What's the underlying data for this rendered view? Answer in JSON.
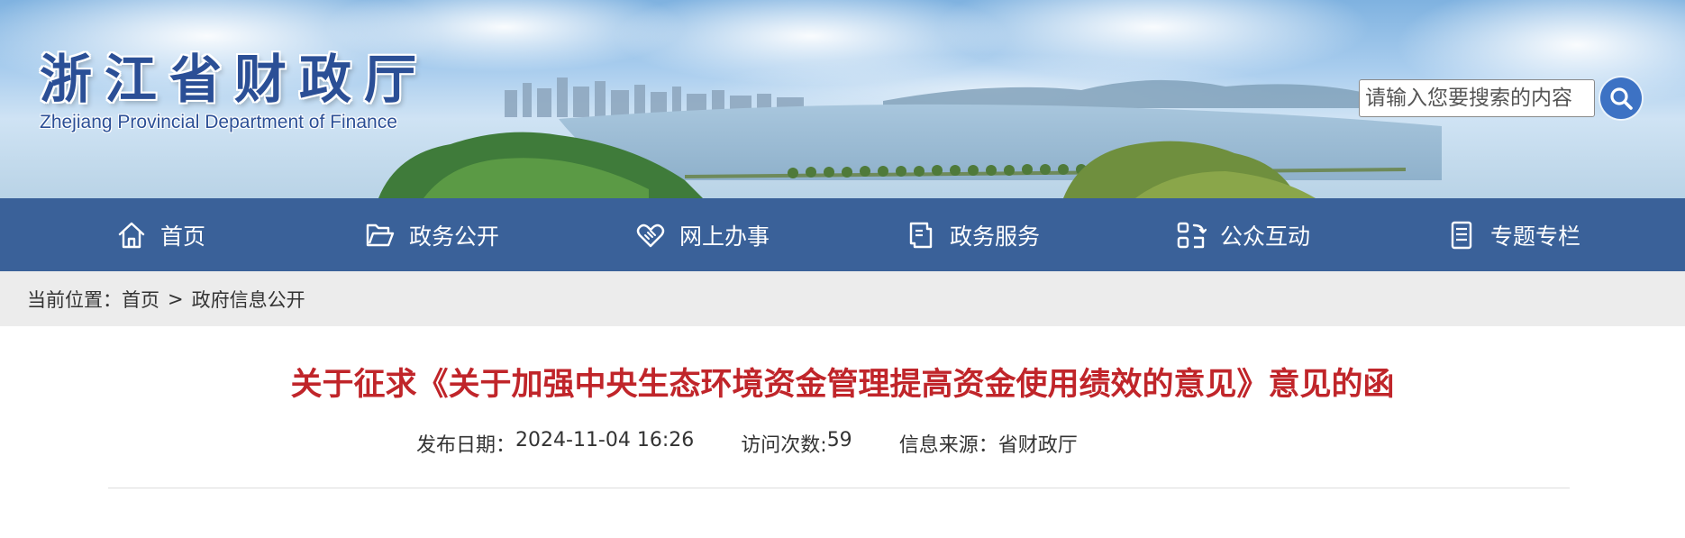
{
  "header": {
    "logo_cn": "浙江省财政厅",
    "logo_en": "Zhejiang Provincial Department of Finance"
  },
  "search": {
    "placeholder": "请输入您要搜索的内容",
    "button_icon": "search-icon"
  },
  "nav": {
    "items": [
      {
        "label": "首页",
        "icon": "home-icon"
      },
      {
        "label": "政务公开",
        "icon": "folder-icon"
      },
      {
        "label": "网上办事",
        "icon": "handshake-icon"
      },
      {
        "label": "政务服务",
        "icon": "document-icon"
      },
      {
        "label": "公众互动",
        "icon": "interaction-icon"
      },
      {
        "label": "专题专栏",
        "icon": "list-icon"
      }
    ],
    "bg_color": "#3a6199"
  },
  "breadcrumb": {
    "prefix": "当前位置：",
    "items": [
      "首页",
      "政府信息公开"
    ],
    "separator": ">"
  },
  "article": {
    "title": "关于征求《关于加强中央生态环境资金管理提高资金使用绩效的意见》意见的函",
    "title_color": "#c0252a",
    "publish_label": "发布日期：",
    "publish_value": "2024-11-04 16:26",
    "visits_label": "访问次数:",
    "visits_value": "59",
    "source_label": "信息来源：",
    "source_value": "省财政厅"
  }
}
